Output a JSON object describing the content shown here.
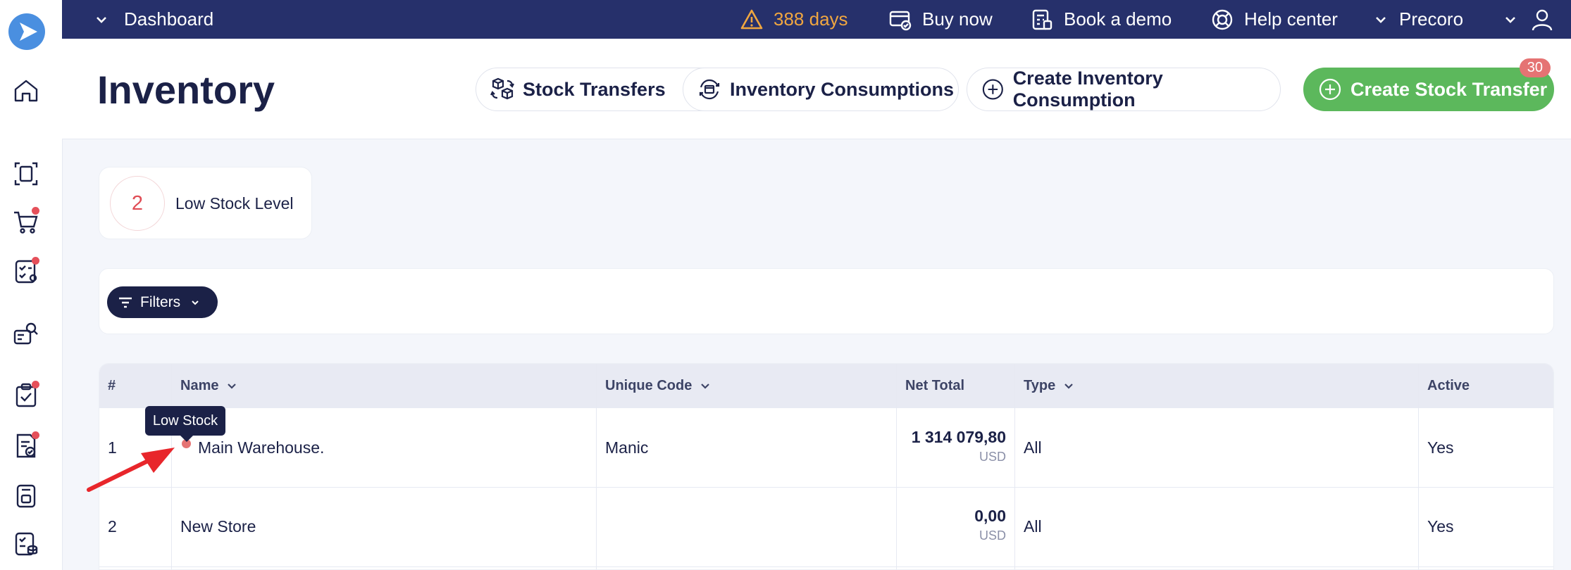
{
  "topbar": {
    "dashboard_label": "Dashboard",
    "trial_days": "388 days",
    "buy_now": "Buy now",
    "book_demo": "Book a demo",
    "help_center": "Help center",
    "company": "Precoro"
  },
  "header": {
    "title": "Inventory",
    "buttons": {
      "stock_transfers": "Stock Transfers",
      "inventory_consumptions": "Inventory Consumptions",
      "create_inventory_consumption": "Create Inventory Consumption",
      "create_stock_transfer": "Create Stock Transfer"
    },
    "badge_count": "30"
  },
  "low_stock": {
    "count": "2",
    "label": "Low Stock Level"
  },
  "filters": {
    "label": "Filters"
  },
  "table": {
    "columns": [
      "#",
      "Name",
      "Unique Code",
      "Net Total",
      "Type",
      "Active"
    ],
    "rows": [
      {
        "num": "1",
        "name": "Main Warehouse.",
        "code": "Manic",
        "net_total": "1 314 079,80",
        "currency": "USD",
        "type": "All",
        "active": "Yes"
      },
      {
        "num": "2",
        "name": "New Store",
        "code": "",
        "net_total": "0,00",
        "currency": "USD",
        "type": "All",
        "active": "Yes"
      }
    ]
  },
  "tooltip": {
    "text": "Low Stock"
  },
  "colors": {
    "topbar": "#26306b",
    "primary_green": "#5cb85c",
    "warning": "#f0a640",
    "alert_red": "#e04c55",
    "navy": "#1b2147"
  },
  "icons": {
    "sidebar": [
      "home-icon",
      "scan-document-icon",
      "cart-icon",
      "approval-list-icon",
      "supplier-search-icon",
      "clipboard-check-icon",
      "invoice-check-icon",
      "receipt-icon",
      "budget-list-icon"
    ]
  }
}
